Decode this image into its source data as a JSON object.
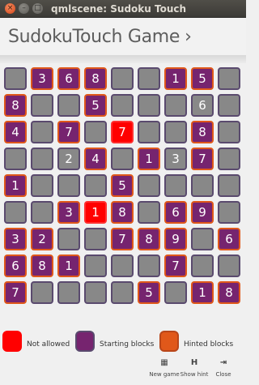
{
  "window": {
    "title": "qmlscene: Sudoku Touch",
    "close_glyph": "×",
    "minimize_glyph": "–",
    "maximize_glyph": "□"
  },
  "header": {
    "title": "SudokuTouch Game",
    "chevron": "›"
  },
  "board": {
    "rows": [
      [
        [
          "empty",
          ""
        ],
        [
          "start",
          "3"
        ],
        [
          "start",
          "6"
        ],
        [
          "start",
          "8"
        ],
        [
          "empty",
          ""
        ],
        [
          "empty",
          ""
        ],
        [
          "start",
          "1"
        ],
        [
          "start",
          "5"
        ],
        [
          "empty",
          ""
        ]
      ],
      [
        [
          "start",
          "8"
        ],
        [
          "empty",
          ""
        ],
        [
          "empty",
          ""
        ],
        [
          "start",
          "5"
        ],
        [
          "empty",
          ""
        ],
        [
          "empty",
          ""
        ],
        [
          "empty",
          ""
        ],
        [
          "hint",
          "6"
        ],
        [
          "empty",
          ""
        ]
      ],
      [
        [
          "start",
          "4"
        ],
        [
          "empty",
          ""
        ],
        [
          "start",
          "7"
        ],
        [
          "empty",
          ""
        ],
        [
          "notallowed",
          "7"
        ],
        [
          "empty",
          ""
        ],
        [
          "empty",
          ""
        ],
        [
          "start",
          "8"
        ],
        [
          "empty",
          ""
        ]
      ],
      [
        [
          "empty",
          ""
        ],
        [
          "empty",
          ""
        ],
        [
          "hint",
          "2"
        ],
        [
          "start",
          "4"
        ],
        [
          "empty",
          ""
        ],
        [
          "start",
          "1"
        ],
        [
          "hint",
          "3"
        ],
        [
          "start",
          "7"
        ],
        [
          "empty",
          ""
        ]
      ],
      [
        [
          "start",
          "1"
        ],
        [
          "empty",
          ""
        ],
        [
          "empty",
          ""
        ],
        [
          "empty",
          ""
        ],
        [
          "start",
          "5"
        ],
        [
          "empty",
          ""
        ],
        [
          "empty",
          ""
        ],
        [
          "empty",
          ""
        ],
        [
          "empty",
          ""
        ]
      ],
      [
        [
          "empty",
          ""
        ],
        [
          "empty",
          ""
        ],
        [
          "start",
          "3"
        ],
        [
          "notallowed",
          "1"
        ],
        [
          "start",
          "8"
        ],
        [
          "empty",
          ""
        ],
        [
          "start",
          "6"
        ],
        [
          "start",
          "9"
        ],
        [
          "empty",
          ""
        ]
      ],
      [
        [
          "start",
          "3"
        ],
        [
          "start",
          "2"
        ],
        [
          "empty",
          ""
        ],
        [
          "empty",
          ""
        ],
        [
          "start",
          "7"
        ],
        [
          "start",
          "8"
        ],
        [
          "start",
          "9"
        ],
        [
          "empty",
          ""
        ],
        [
          "start",
          "6"
        ]
      ],
      [
        [
          "start",
          "6"
        ],
        [
          "start",
          "8"
        ],
        [
          "start",
          "1"
        ],
        [
          "empty",
          ""
        ],
        [
          "empty",
          ""
        ],
        [
          "empty",
          ""
        ],
        [
          "start",
          "7"
        ],
        [
          "empty",
          ""
        ],
        [
          "empty",
          ""
        ]
      ],
      [
        [
          "start",
          "7"
        ],
        [
          "empty",
          ""
        ],
        [
          "empty",
          ""
        ],
        [
          "empty",
          ""
        ],
        [
          "empty",
          ""
        ],
        [
          "start",
          "5"
        ],
        [
          "empty",
          ""
        ],
        [
          "start",
          "1"
        ],
        [
          "start",
          "8"
        ]
      ]
    ]
  },
  "legend": {
    "items": [
      {
        "label": "Not allowed",
        "color": "#ff0000"
      },
      {
        "label": "Starting blocks",
        "color": "#76246f"
      },
      {
        "label": "Hinted blocks",
        "color": "#e0581a"
      }
    ]
  },
  "toolbar": {
    "items": [
      {
        "label": "New game",
        "icon": "grid-icon",
        "glyph": "▦"
      },
      {
        "label": "Show hint",
        "icon": "hint-icon",
        "glyph": "H"
      },
      {
        "label": "Close",
        "icon": "exit-icon",
        "glyph": "⇥"
      }
    ]
  }
}
